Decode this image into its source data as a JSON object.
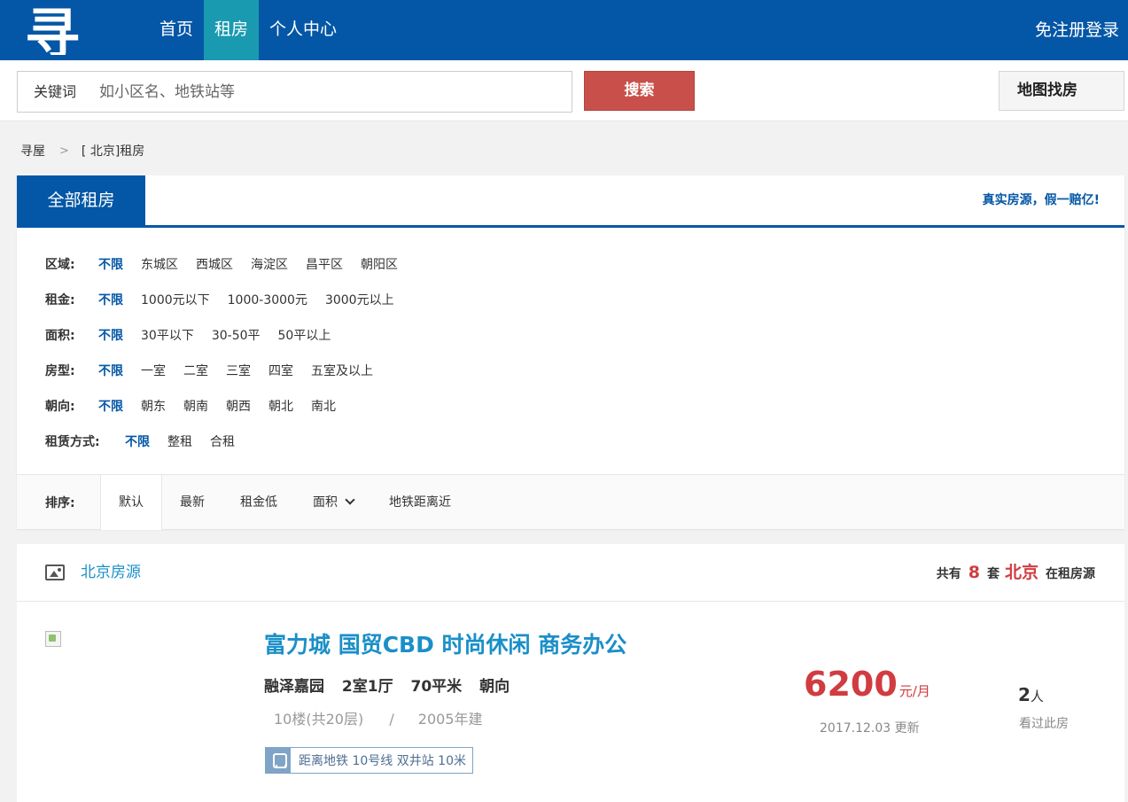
{
  "header": {
    "logo_text": "寻屋",
    "nav": [
      {
        "label": "首页"
      },
      {
        "label": "租房"
      },
      {
        "label": "个人中心"
      }
    ],
    "login_label": "免注册登录"
  },
  "search": {
    "label": "关键词",
    "placeholder": "如小区名、地铁站等",
    "button_label": "搜索",
    "map_button_label": "地图找房"
  },
  "breadcrumb": {
    "items": [
      "寻屋",
      "[ 北京]租房"
    ]
  },
  "filter": {
    "tab_label": "全部租房",
    "slogan": "真实房源，假一赔亿!",
    "rows": [
      {
        "label": "区域:",
        "options": [
          "不限",
          "东城区",
          "西城区",
          "海淀区",
          "昌平区",
          "朝阳区"
        ]
      },
      {
        "label": "租金:",
        "options": [
          "不限",
          "1000元以下",
          "1000-3000元",
          "3000元以上"
        ]
      },
      {
        "label": "面积:",
        "options": [
          "不限",
          "30平以下",
          "30-50平",
          "50平以上"
        ]
      },
      {
        "label": "房型:",
        "options": [
          "不限",
          "一室",
          "二室",
          "三室",
          "四室",
          "五室及以上"
        ]
      },
      {
        "label": "朝向:",
        "options": [
          "不限",
          "朝东",
          "朝南",
          "朝西",
          "朝北",
          "南北"
        ]
      },
      {
        "label": "租赁方式:",
        "options": [
          "不限",
          "整租",
          "合租"
        ]
      }
    ],
    "sort": {
      "label": "排序:",
      "items": [
        "默认",
        "最新",
        "租金低",
        "面积",
        "地铁距离近"
      ]
    }
  },
  "listing": {
    "title": "北京房源",
    "count_prefix": "共有",
    "count": "8",
    "count_unit": "套",
    "city": "北京",
    "count_suffix": "在租房源",
    "houses": [
      {
        "title": "富力城 国贸CBD 时尚休闲 商务办公",
        "community": "融泽嘉园",
        "layout": "2室1厅",
        "area": "70平米",
        "orientation": "朝向",
        "floor": "10楼(共20层)",
        "slash": "/",
        "built": "2005年建",
        "subway": "距离地铁 10号线 双井站 10米",
        "price": "6200",
        "price_unit": "元/月",
        "updated": "2017.12.03 更新",
        "views": "2",
        "views_unit": "人",
        "views_label": "看过此房"
      }
    ]
  },
  "colors": {
    "brand_blue": "#0457a6",
    "nav_active": "#1a9ab0",
    "search_red": "#c9504a",
    "price_red": "#d03c40",
    "link_blue": "#1a8fc8"
  }
}
